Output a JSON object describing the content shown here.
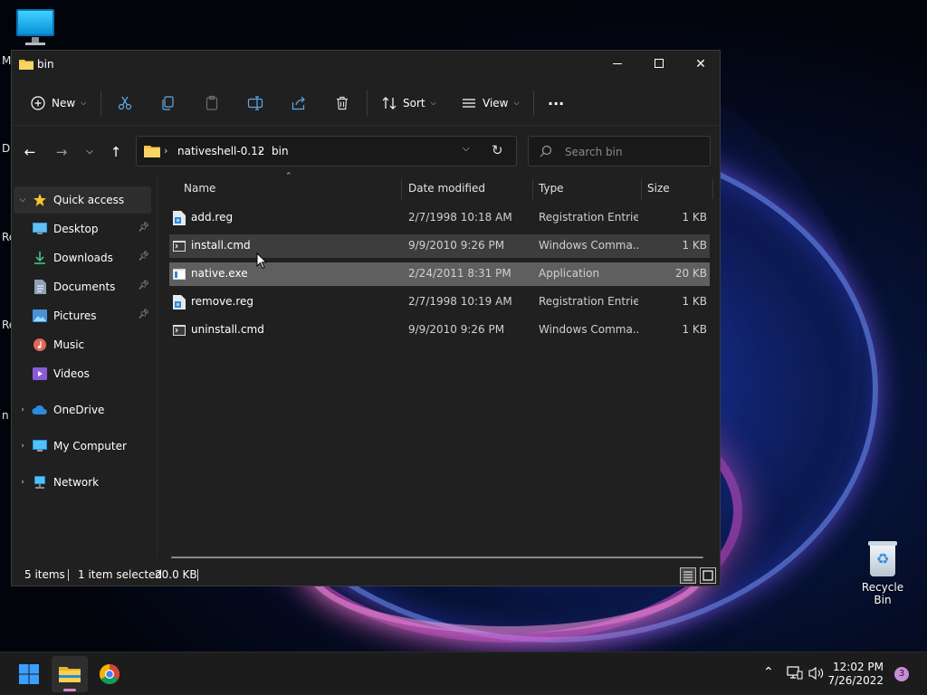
{
  "desktop": {
    "edge_letters": [
      "M",
      "D",
      "Re",
      "Re",
      "n"
    ],
    "recycle_bin_label": "Recycle Bin"
  },
  "window": {
    "title": "bin",
    "toolbar": {
      "new_label": "New",
      "sort_label": "Sort",
      "view_label": "View",
      "more_label": "···"
    },
    "address": {
      "segments": [
        "nativeshell-0.12",
        "bin"
      ],
      "search_placeholder": "Search bin"
    },
    "nav_pane": {
      "quick_access": "Quick access",
      "items": [
        {
          "label": "Desktop",
          "icon": "desktop-icon",
          "pinned": true
        },
        {
          "label": "Downloads",
          "icon": "download-icon",
          "pinned": true
        },
        {
          "label": "Documents",
          "icon": "document-icon",
          "pinned": true
        },
        {
          "label": "Pictures",
          "icon": "pictures-icon",
          "pinned": true
        },
        {
          "label": "Music",
          "icon": "music-icon",
          "pinned": false
        },
        {
          "label": "Videos",
          "icon": "videos-icon",
          "pinned": false
        }
      ],
      "onedrive": "OneDrive",
      "my_computer": "My Computer",
      "network": "Network"
    },
    "columns": {
      "name": "Name",
      "date": "Date modified",
      "type": "Type",
      "size": "Size"
    },
    "files": [
      {
        "name": "add.reg",
        "date": "2/7/1998 10:18 AM",
        "type": "Registration Entries",
        "size": "1 KB",
        "icon": "reg-file-icon",
        "state": "normal"
      },
      {
        "name": "install.cmd",
        "date": "9/9/2010 9:26 PM",
        "type": "Windows Comma...",
        "size": "1 KB",
        "icon": "cmd-file-icon",
        "state": "hover"
      },
      {
        "name": "native.exe",
        "date": "2/24/2011 8:31 PM",
        "type": "Application",
        "size": "20 KB",
        "icon": "exe-file-icon",
        "state": "selected"
      },
      {
        "name": "remove.reg",
        "date": "2/7/1998 10:19 AM",
        "type": "Registration Entries",
        "size": "1 KB",
        "icon": "reg-file-icon",
        "state": "normal"
      },
      {
        "name": "uninstall.cmd",
        "date": "9/9/2010 9:26 PM",
        "type": "Windows Comma...",
        "size": "1 KB",
        "icon": "cmd-file-icon",
        "state": "normal"
      }
    ],
    "status": {
      "item_count": "5 items",
      "selection": "1 item selected",
      "selection_size": "20.0 KB"
    }
  },
  "taskbar": {
    "time": "12:02 PM",
    "date": "7/26/2022",
    "notification_count": "3"
  },
  "colors": {
    "window_bg": "#202020",
    "selected_row": "#5f5f5f",
    "hover_row": "#3d3d3d",
    "accent_folder": "#f3c342",
    "taskbar_bg": "#1c1c1c"
  }
}
